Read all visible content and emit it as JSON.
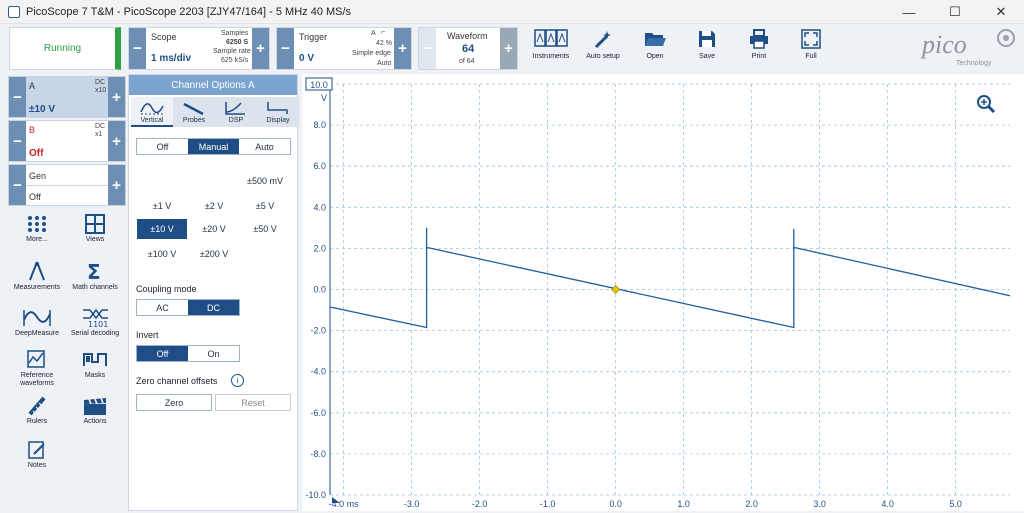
{
  "window": {
    "title": "PicoScope 7 T&M  - PicoScope 2203 [ZJY47/164] - 5 MHz 40 MS/s",
    "min": "—",
    "max": "☐",
    "close": "✕"
  },
  "run": {
    "label": "Running"
  },
  "scope": {
    "label": "Scope",
    "timebase": "1 ms/div",
    "samples_label": "Samples",
    "samples": "6250 S",
    "rate_label": "Sample rate",
    "rate": "625 kS/s"
  },
  "trigger": {
    "label": "Trigger",
    "level": "0 V",
    "channel": "A",
    "pct": "42 %",
    "type": "Simple edge",
    "mode": "Auto"
  },
  "waveform": {
    "label": "Waveform",
    "index": "64",
    "of": "of 64"
  },
  "tools": [
    {
      "label": "Instruments"
    },
    {
      "label": "Auto setup"
    },
    {
      "label": "Open"
    },
    {
      "label": "Save"
    },
    {
      "label": "Print"
    },
    {
      "label": "Full"
    }
  ],
  "logo": {
    "text": "pico",
    "sub": "Technology"
  },
  "channels": {
    "a": {
      "name": "A",
      "coupling": "DC",
      "probe": "x10",
      "range": "±10 V"
    },
    "b": {
      "name": "B",
      "coupling": "DC",
      "probe": "x1",
      "range": "Off"
    },
    "gen": {
      "name": "Gen",
      "state": "Off"
    }
  },
  "sidetools": [
    {
      "label": "More..."
    },
    {
      "label": "Views"
    },
    {
      "label": "Measurements"
    },
    {
      "label": "Math channels"
    },
    {
      "label": "DeepMeasure"
    },
    {
      "label": "Serial decoding"
    },
    {
      "label": "Reference waveforms"
    },
    {
      "label": "Masks"
    },
    {
      "label": "Rulers"
    },
    {
      "label": "Actions"
    },
    {
      "label": "Notes"
    }
  ],
  "options": {
    "header": "Channel Options A",
    "tabs": [
      "Vertical",
      "Probes",
      "DSP",
      "Display"
    ],
    "mode": [
      "Off",
      "Manual",
      "Auto"
    ],
    "ranges": [
      "±500 mV",
      "±1 V",
      "±2 V",
      "±5 V",
      "±10 V",
      "±20 V",
      "±50 V",
      "±100 V",
      "±200 V"
    ],
    "coupling_label": "Coupling mode",
    "coupling": [
      "AC",
      "DC"
    ],
    "invert_label": "Invert",
    "invert": [
      "Off",
      "On"
    ],
    "zero_label": "Zero channel offsets",
    "zero": "Zero",
    "reset": "Reset"
  },
  "chart_data": {
    "type": "line",
    "title": "",
    "xlabel": "ms",
    "ylabel": "V",
    "xlim": [
      -4.2,
      5.8
    ],
    "ylim": [
      -10.0,
      10.0
    ],
    "x_ticks": [
      "-4.0",
      "-3.0",
      "-2.0",
      "-1.0",
      "0.0",
      "1.0",
      "2.0",
      "3.0",
      "4.0",
      "5.0"
    ],
    "y_ticks": [
      "10.0",
      "8.0",
      "6.0",
      "4.0",
      "2.0",
      "0.0",
      "-2.0",
      "-4.0",
      "-6.0",
      "-8.0",
      "-10.0"
    ],
    "x_unit_label": "-4.0 ms",
    "grid": true,
    "series": [
      {
        "color": "#1f5fa0",
        "x": [
          -4.2,
          -2.78,
          -2.78,
          -2.78,
          2.62,
          2.62,
          2.62,
          5.8
        ],
        "y": [
          -0.85,
          -1.85,
          3.0,
          2.05,
          -1.85,
          2.95,
          2.05,
          -0.3
        ]
      }
    ],
    "trigger_marker": {
      "x": 0.0,
      "y": 0.0,
      "color": "#e6c800"
    }
  }
}
